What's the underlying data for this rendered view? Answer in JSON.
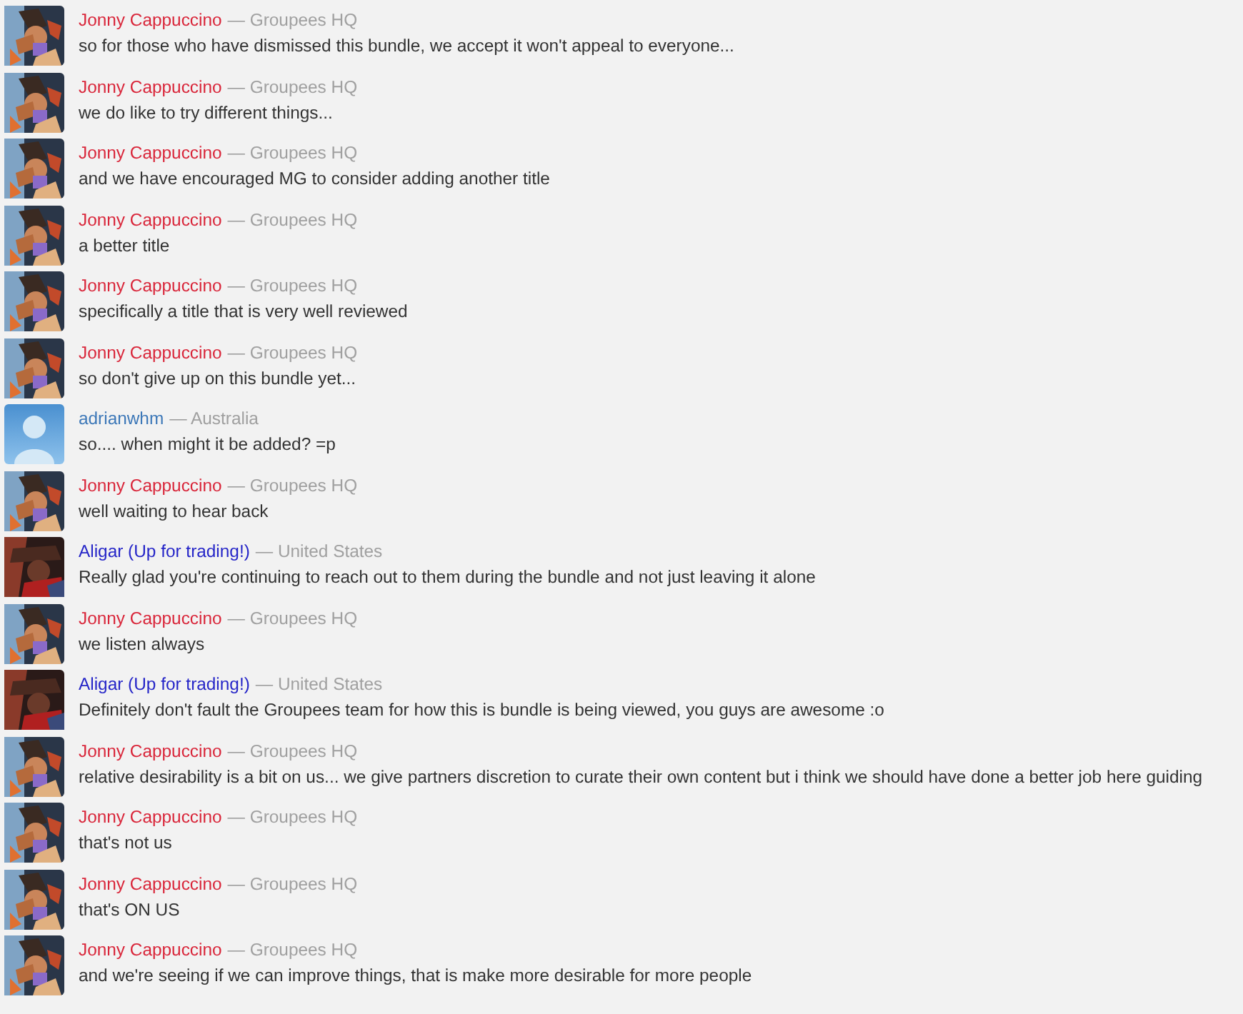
{
  "messages": [
    {
      "avatar": {
        "kind": "staff"
      },
      "author": "Jonny Cappuccino",
      "color": "#d9263a",
      "location": "— Groupees HQ",
      "text": "so for those who have dismissed this bundle, we accept it won't appeal to everyone..."
    },
    {
      "avatar": {
        "kind": "staff"
      },
      "author": "Jonny Cappuccino",
      "color": "#d9263a",
      "location": "— Groupees HQ",
      "text": "we do like to try different things..."
    },
    {
      "avatar": {
        "kind": "staff"
      },
      "author": "Jonny Cappuccino",
      "color": "#d9263a",
      "location": "— Groupees HQ",
      "text": "and we have encouraged MG to consider adding another title"
    },
    {
      "avatar": {
        "kind": "staff"
      },
      "author": "Jonny Cappuccino",
      "color": "#d9263a",
      "location": "— Groupees HQ",
      "text": "a better title"
    },
    {
      "avatar": {
        "kind": "staff"
      },
      "author": "Jonny Cappuccino",
      "color": "#d9263a",
      "location": "— Groupees HQ",
      "text": "specifically a title that is very well reviewed"
    },
    {
      "avatar": {
        "kind": "staff"
      },
      "author": "Jonny Cappuccino",
      "color": "#d9263a",
      "location": "— Groupees HQ",
      "text": "so don't give up on this bundle yet..."
    },
    {
      "avatar": {
        "kind": "default"
      },
      "author": "adrianwhm",
      "color": "#3d78b8",
      "location": "— Australia",
      "text": "so.... when might it be added? =p"
    },
    {
      "avatar": {
        "kind": "staff"
      },
      "author": "Jonny Cappuccino",
      "color": "#d9263a",
      "location": "— Groupees HQ",
      "text": "well waiting to hear back"
    },
    {
      "avatar": {
        "kind": "user"
      },
      "author": "Aligar (Up for trading!)",
      "color": "#2626c8",
      "location": "— United States",
      "text": "Really glad you're continuing to reach out to them during the bundle and not just leaving it alone"
    },
    {
      "avatar": {
        "kind": "staff"
      },
      "author": "Jonny Cappuccino",
      "color": "#d9263a",
      "location": "— Groupees HQ",
      "text": "we listen always"
    },
    {
      "avatar": {
        "kind": "user"
      },
      "author": "Aligar (Up for trading!)",
      "color": "#2626c8",
      "location": "— United States",
      "text": "Definitely don't fault the Groupees team for how this is bundle is being viewed, you guys are awesome :o"
    },
    {
      "avatar": {
        "kind": "staff"
      },
      "author": "Jonny Cappuccino",
      "color": "#d9263a",
      "location": "— Groupees HQ",
      "text": "relative desirability is a bit on us... we give partners discretion to curate their own content but i think we should have done a better job here guiding"
    },
    {
      "avatar": {
        "kind": "staff"
      },
      "author": "Jonny Cappuccino",
      "color": "#d9263a",
      "location": "— Groupees HQ",
      "text": "that's not us"
    },
    {
      "avatar": {
        "kind": "staff"
      },
      "author": "Jonny Cappuccino",
      "color": "#d9263a",
      "location": "— Groupees HQ",
      "text": "that's ON US"
    },
    {
      "avatar": {
        "kind": "staff"
      },
      "author": "Jonny Cappuccino",
      "color": "#d9263a",
      "location": "— Groupees HQ",
      "text": "and we're seeing if we can improve things, that is make more desirable for more people"
    }
  ]
}
